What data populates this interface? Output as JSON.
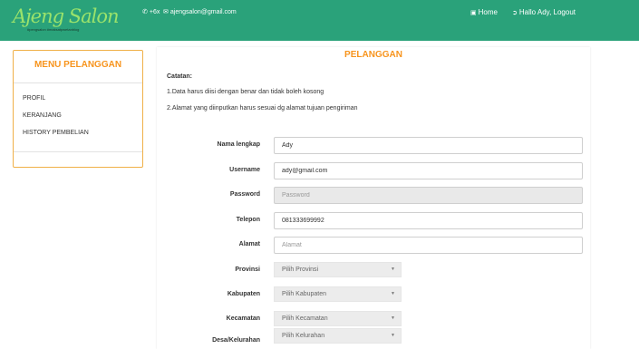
{
  "header": {
    "logo_text": "Ajeng Salon",
    "logo_tagline": "#pengsalon #maksatpwetanblog",
    "phone": "+6x",
    "email": "ajengsalon@gmail.com",
    "home_label": "Home",
    "user_label": "Hallo Ady, Logout"
  },
  "sidebar": {
    "title": "MENU PELANGGAN",
    "items": [
      {
        "label": "PROFIL"
      },
      {
        "label": "KERANJANG"
      },
      {
        "label": "HISTORY PEMBELIAN"
      }
    ]
  },
  "main": {
    "title": "PELANGGAN",
    "note_title": "Catatan:",
    "notes": [
      "1.Data harus diisi dengan benar dan tidak boleh kosong",
      "2.Alamat yang diinputkan harus sesuai dg alamat tujuan pengiriman"
    ],
    "fields": {
      "nama": {
        "label": "Nama lengkap",
        "value": "Ady",
        "placeholder": ""
      },
      "username": {
        "label": "Username",
        "value": "ady@gmail.com",
        "placeholder": ""
      },
      "password": {
        "label": "Password",
        "value": "",
        "placeholder": "Password"
      },
      "telepon": {
        "label": "Telepon",
        "value": "081333699992",
        "placeholder": ""
      },
      "alamat": {
        "label": "Alamat",
        "value": "",
        "placeholder": "Alamat"
      }
    },
    "selects": {
      "provinsi": {
        "label": "Provinsi",
        "selected": "Pilih Provinsi"
      },
      "kabupaten": {
        "label": "Kabupaten",
        "selected": "Pilih Kabupaten"
      },
      "kecamatan": {
        "label": "Kecamatan",
        "selected": "Pilih Kecamatan"
      },
      "kelurahan": {
        "label": "Desa/Kelurahan",
        "selected": "Pilih Kelurahan"
      }
    }
  },
  "colors": {
    "header_bg": "#2aa27a",
    "accent": "#f7941d",
    "sidebar_border": "#f0b048"
  }
}
